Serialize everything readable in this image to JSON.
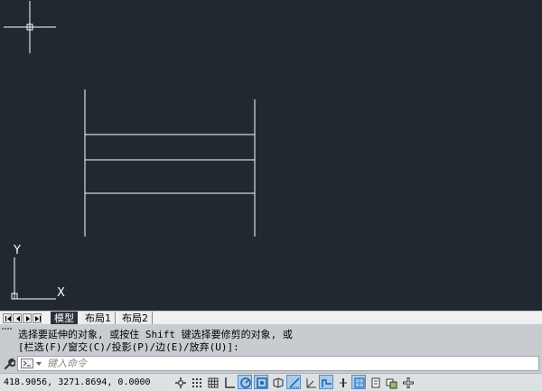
{
  "canvas": {
    "background": "#212830",
    "ucs_x_label": "X",
    "ucs_y_label": "Y"
  },
  "layout_tabs": {
    "items": [
      {
        "label": "模型",
        "active": true
      },
      {
        "label": "布局1",
        "active": false
      },
      {
        "label": "布局2",
        "active": false
      }
    ]
  },
  "command": {
    "history_line1": "选择要延伸的对象, 或按住 Shift 键选择要修剪的对象, 或",
    "history_line2": "[栏选(F)/窗交(C)/投影(P)/边(E)/放弃(U)]:",
    "input_placeholder": "键入命令",
    "input_value": ""
  },
  "status": {
    "coordinates": "418.9056,  3271.8694, 0.0000",
    "buttons": [
      {
        "icon": "infer-constraints-icon",
        "on": false
      },
      {
        "icon": "snap-mode-icon",
        "on": false
      },
      {
        "icon": "grid-display-icon",
        "on": false
      },
      {
        "icon": "ortho-mode-icon",
        "on": false
      },
      {
        "icon": "polar-tracking-icon",
        "on": true
      },
      {
        "icon": "object-snap-icon",
        "on": true
      },
      {
        "icon": "3d-object-snap-icon",
        "on": false
      },
      {
        "icon": "object-snap-tracking-icon",
        "on": true
      },
      {
        "icon": "dynamic-ucs-icon",
        "on": false
      },
      {
        "icon": "dynamic-input-icon",
        "on": true
      },
      {
        "icon": "lineweight-icon",
        "on": false
      },
      {
        "icon": "transparency-icon",
        "on": true
      },
      {
        "icon": "quick-properties-icon",
        "on": false
      },
      {
        "icon": "selection-cycling-icon",
        "on": false
      },
      {
        "icon": "annotation-monitor-icon",
        "on": false
      }
    ]
  }
}
